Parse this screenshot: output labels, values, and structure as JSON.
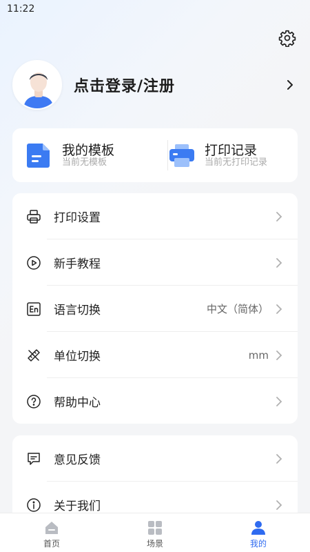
{
  "status_bar": {
    "time": "11:22"
  },
  "profile": {
    "login_text": "点击登录/注册"
  },
  "quick": [
    {
      "title": "我的模板",
      "subtitle": "当前无模板",
      "icon": "template-icon"
    },
    {
      "title": "打印记录",
      "subtitle": "当前无打印记录",
      "icon": "printer-record-icon"
    }
  ],
  "menu_group_1": [
    {
      "label": "打印设置",
      "value": "",
      "icon": "printer-settings-icon"
    },
    {
      "label": "新手教程",
      "value": "",
      "icon": "play-circle-icon"
    },
    {
      "label": "语言切换",
      "value": "中文（简体）",
      "icon": "language-en-icon"
    },
    {
      "label": "单位切换",
      "value": "mm",
      "icon": "ruler-pencil-icon"
    },
    {
      "label": "帮助中心",
      "value": "",
      "icon": "help-circle-icon"
    }
  ],
  "menu_group_2": [
    {
      "label": "意见反馈",
      "value": "",
      "icon": "feedback-message-icon"
    },
    {
      "label": "关于我们",
      "value": "",
      "icon": "info-circle-icon"
    }
  ],
  "nav": [
    {
      "label": "首页",
      "icon": "home-icon",
      "active": false
    },
    {
      "label": "场景",
      "icon": "grid-icon",
      "active": false
    },
    {
      "label": "我的",
      "icon": "user-icon",
      "active": true
    }
  ],
  "colors": {
    "accent": "#2f6bf0",
    "icon_blue": "#3b82f6",
    "background": "#f4f5f7"
  }
}
